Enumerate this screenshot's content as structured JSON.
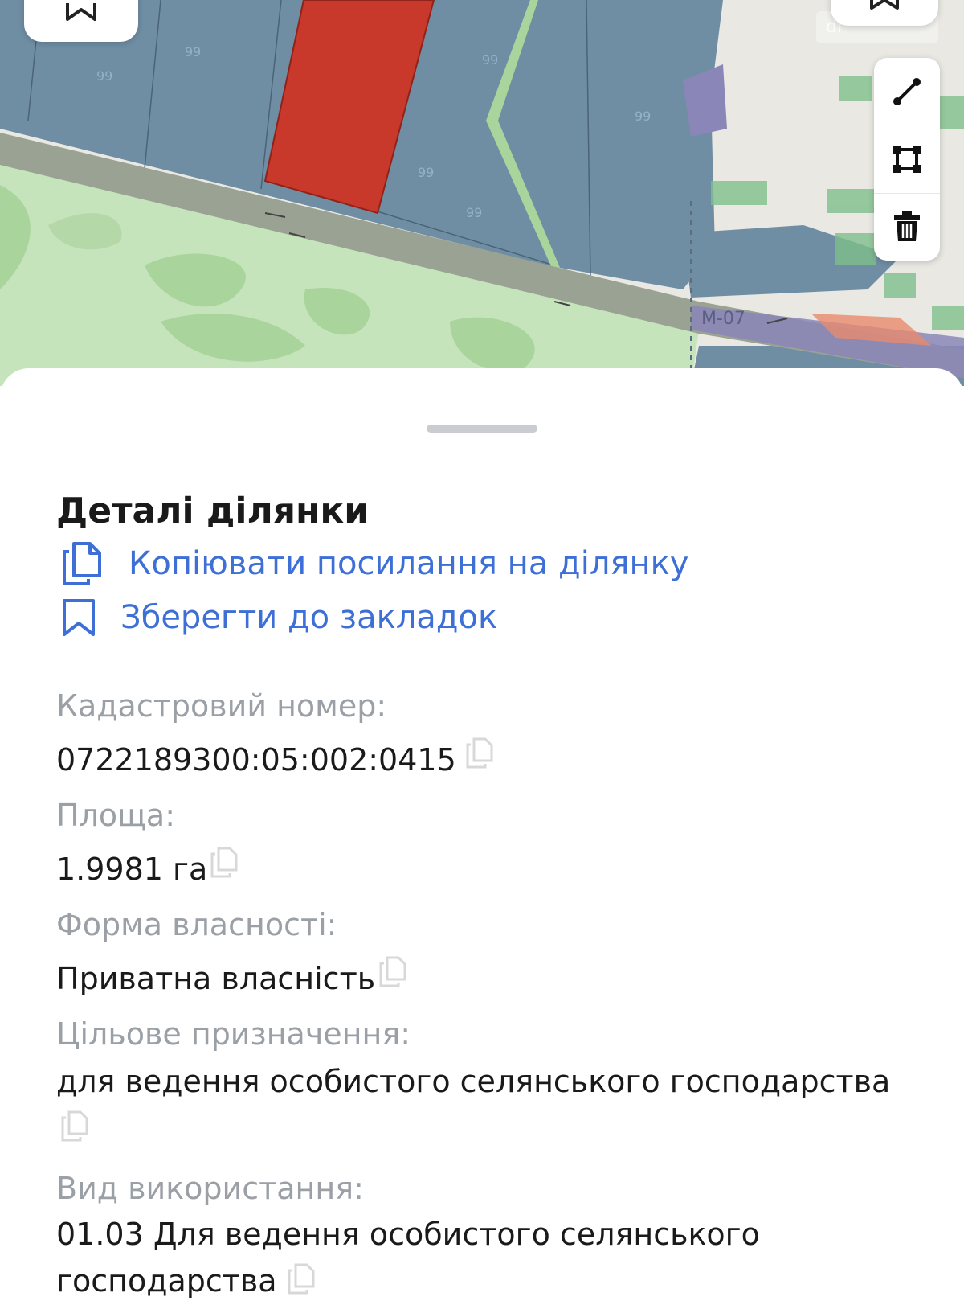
{
  "map": {
    "road_label": "M-07",
    "watermark": "dr",
    "colors": {
      "parcel_blue": "#6f8ea4",
      "selected_parcel": "#c8382b",
      "forest_green": "#bfe0b5",
      "road": "#9aa294",
      "highway_purple": "#8a86b8"
    },
    "icons": {
      "top_left": "bookmark-icon",
      "top_right": "bookmark-icon",
      "tool_line": "line-measure-icon",
      "tool_area": "area-measure-icon",
      "tool_delete": "trash-icon"
    }
  },
  "sheet": {
    "title": "Деталі ділянки",
    "copy_link_label": "Копіювати посилання на ділянку",
    "bookmark_label": "Зберегти до закладок",
    "fields": {
      "cadastral": {
        "label": "Кадастровий номер:",
        "value": "0722189300:05:002:0415"
      },
      "area": {
        "label": "Площа:",
        "value": "1.9981 га"
      },
      "ownership": {
        "label": "Форма власності:",
        "value": "Приватна власність"
      },
      "purpose": {
        "label": "Цільове призначення:",
        "value": "для ведення особистого селянського господарства"
      },
      "usage": {
        "label": "Вид використання:",
        "value_line1": "01.03 Для ведення особистого селянського",
        "value_line2": "господарства"
      }
    },
    "colors": {
      "link": "#3d6fd6",
      "label_gray": "#9aa0a6",
      "text": "#1a1a1a"
    }
  }
}
